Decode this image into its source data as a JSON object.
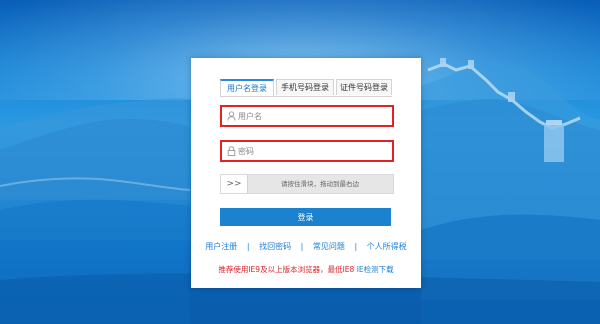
{
  "tabs": [
    {
      "label": "用户名登录",
      "active": true
    },
    {
      "label": "手机号码登录",
      "active": false
    },
    {
      "label": "证件号码登录",
      "active": false
    }
  ],
  "form": {
    "username_placeholder": "用户名",
    "password_placeholder": "密码",
    "username_icon": "user-icon",
    "password_icon": "lock-icon",
    "error_border_color": "#e02424"
  },
  "slider": {
    "handle_glyph": ">>",
    "text": "请按住滑块，拖动到最右边"
  },
  "login_button": {
    "label": "登录",
    "color": "#1a82cf"
  },
  "links": {
    "register": "用户注册",
    "forgot_password": "找回密码",
    "faq": "常见问题",
    "separator": "|",
    "personal_tax": "个人所得税"
  },
  "notice": {
    "text": "推荐使用IE9及以上版本浏览器，最低IE8",
    "download": "IE检测下载"
  }
}
